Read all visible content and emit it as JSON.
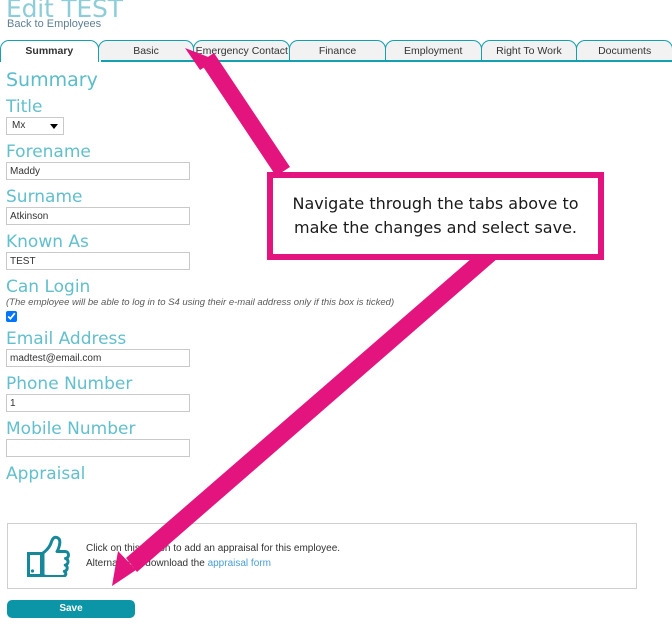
{
  "header": {
    "title": "Edit TEST",
    "back_link": "Back to Employees"
  },
  "tabs": [
    {
      "label": "Summary",
      "active": true
    },
    {
      "label": "Basic",
      "active": false
    },
    {
      "label": "Emergency Contact",
      "active": false
    },
    {
      "label": "Finance",
      "active": false
    },
    {
      "label": "Employment",
      "active": false
    },
    {
      "label": "Right To Work",
      "active": false
    },
    {
      "label": "Documents",
      "active": false
    }
  ],
  "form": {
    "section_heading": "Summary",
    "title_label": "Title",
    "title_value": "Mx",
    "forename_label": "Forename",
    "forename_value": "Maddy",
    "surname_label": "Surname",
    "surname_value": "Atkinson",
    "known_as_label": "Known As",
    "known_as_value": "TEST",
    "can_login_label": "Can Login",
    "can_login_hint": "(The employee will be able to log in to S4 using their e-mail address only if this box is ticked)",
    "can_login_checked": true,
    "email_label": "Email Address",
    "email_value": "madtest@email.com",
    "phone_label": "Phone Number",
    "phone_value": "1",
    "mobile_label": "Mobile Number",
    "mobile_value": "",
    "appraisal_label": "Appraisal"
  },
  "appraisal": {
    "line1": "Click on this button to add an appraisal for this employee.",
    "line2_prefix": "Alternatively, download the ",
    "link_text": "appraisal form"
  },
  "save_button": "Save",
  "annotation": {
    "callout_text": "Navigate through the tabs above to make the changes and select save."
  },
  "colors": {
    "teal": "#0c95a6",
    "tab_border": "#15a0b0",
    "label_teal": "#62bfcd",
    "title_teal": "#8ccdd8",
    "annotation_pink": "#e4147f",
    "link_blue": "#4a9ed4"
  }
}
